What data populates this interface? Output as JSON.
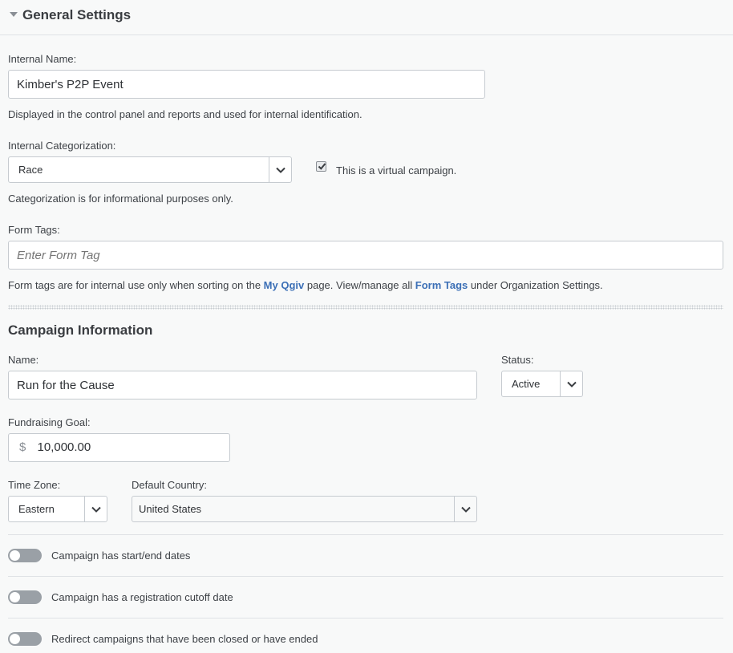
{
  "general_settings": {
    "title": "General Settings",
    "internal_name": {
      "label": "Internal Name:",
      "value": "Kimber's P2P Event",
      "help": "Displayed in the control panel and reports and used for internal identification."
    },
    "internal_categorization": {
      "label": "Internal Categorization:",
      "selected": "Race",
      "help": "Categorization is for informational purposes only."
    },
    "virtual_campaign": {
      "label": "This is a virtual campaign.",
      "checked": true
    },
    "form_tags": {
      "label": "Form Tags:",
      "placeholder": "Enter Form Tag",
      "help_part1": "Form tags are for internal use only when sorting on the ",
      "help_link1": "My Qgiv",
      "help_part2": " page. View/manage all ",
      "help_link2": "Form Tags",
      "help_part3": " under Organization Settings."
    }
  },
  "campaign_information": {
    "title": "Campaign Information",
    "name": {
      "label": "Name:",
      "value": "Run for the Cause"
    },
    "status": {
      "label": "Status:",
      "selected": "Active"
    },
    "fundraising_goal": {
      "label": "Fundraising Goal:",
      "currency_symbol": "$",
      "value": "10,000.00"
    },
    "time_zone": {
      "label": "Time Zone:",
      "selected": "Eastern"
    },
    "default_country": {
      "label": "Default Country:",
      "selected": "United States"
    },
    "toggles": [
      {
        "label": "Campaign has start/end dates",
        "on": false
      },
      {
        "label": "Campaign has a registration cutoff date",
        "on": false
      },
      {
        "label": "Redirect campaigns that have been closed or have ended",
        "on": false
      }
    ]
  },
  "colors": {
    "background": "#f8f9f9",
    "link": "#3b6fb6",
    "border": "#c6cbd0",
    "toggle_off": "#9aa0a6"
  }
}
